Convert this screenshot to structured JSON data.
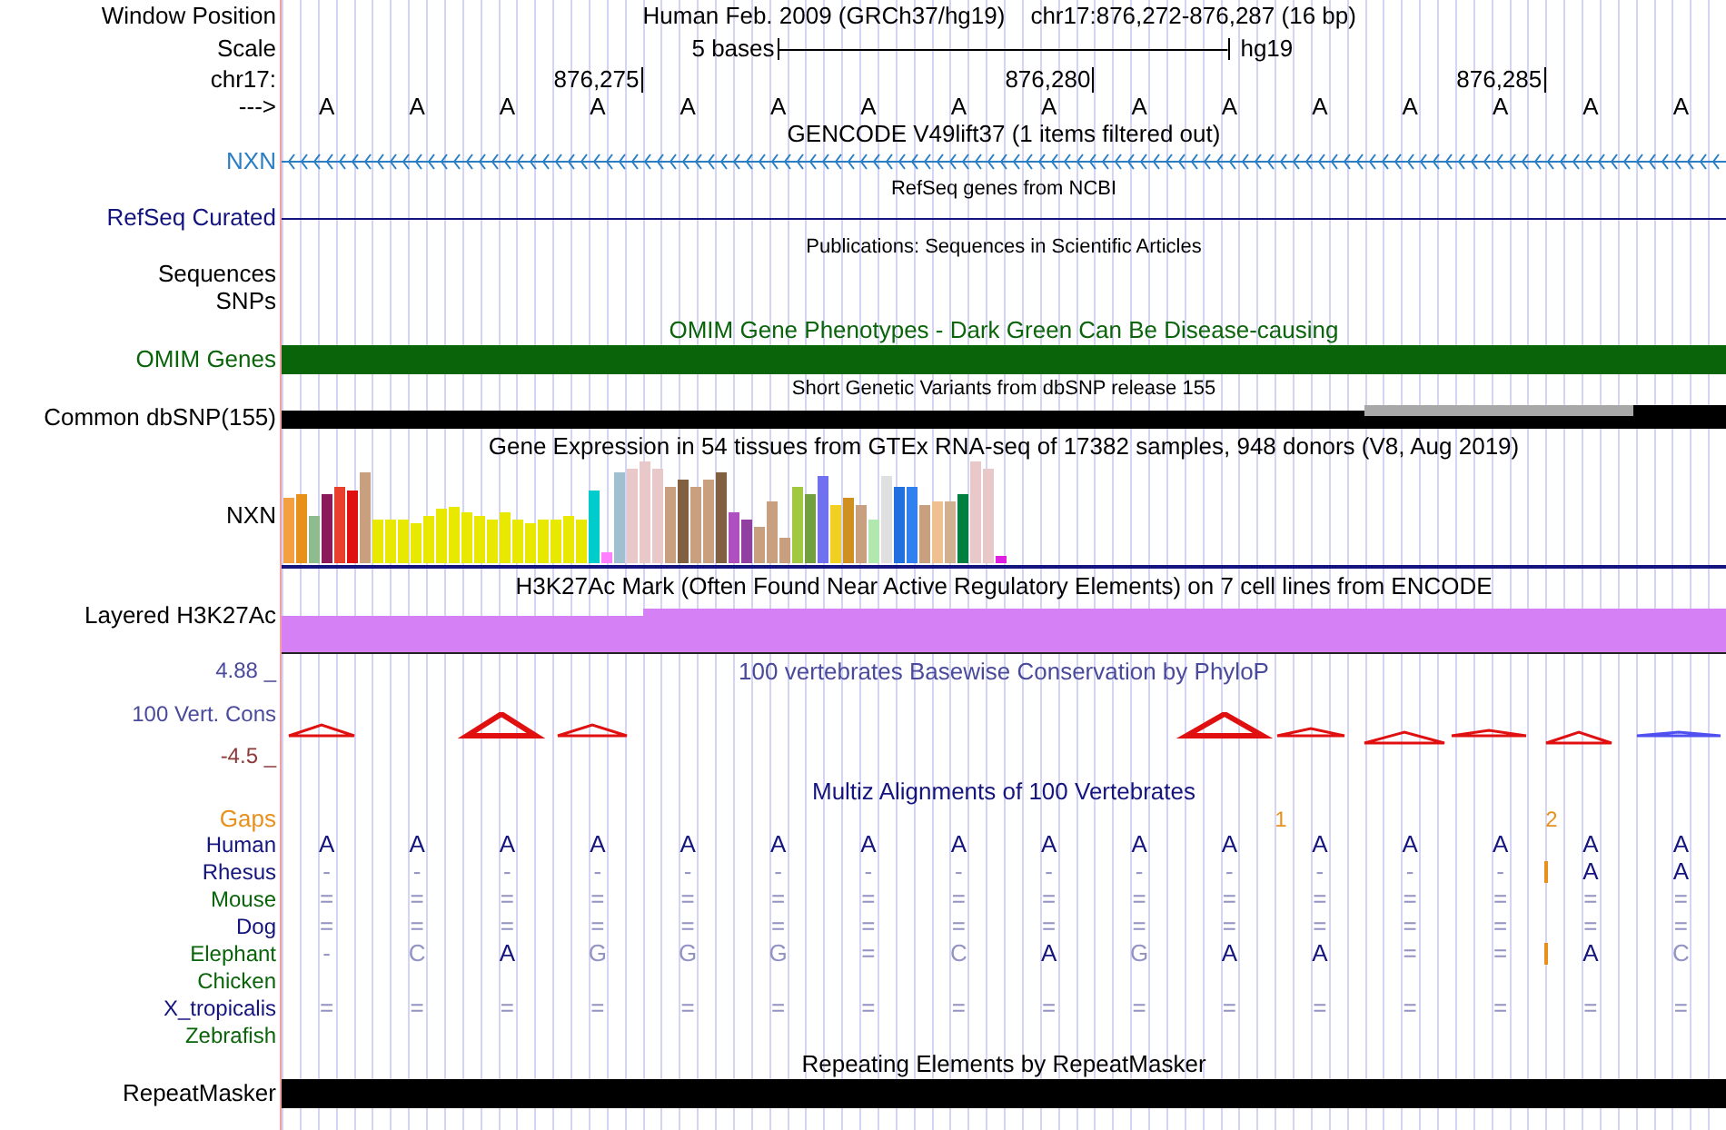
{
  "ruler": {
    "position_label": "Window Position",
    "assembly": "Human Feb. 2009 (GRCh37/hg19)",
    "range": "chr17:876,272-876,287 (16 bp)",
    "scale_label": "Scale",
    "scale_text": "5 bases",
    "scale_db": "hg19",
    "chrom_label": "chr17:",
    "ticks": [
      "876,275",
      "876,280",
      "876,285"
    ],
    "strand_label": "--->",
    "bases": [
      "A",
      "A",
      "A",
      "A",
      "A",
      "A",
      "A",
      "A",
      "A",
      "A",
      "A",
      "A",
      "A",
      "A",
      "A",
      "A"
    ]
  },
  "tracks": [
    {
      "kind": "gene",
      "title": "GENCODE V49lift37 (1 items filtered out)",
      "labels": [
        "NXN"
      ],
      "color": "#2a7ec4"
    },
    {
      "kind": "line",
      "title": "RefSeq genes from NCBI",
      "labels": [
        "RefSeq Curated"
      ],
      "color": "#14147e"
    },
    {
      "kind": "empty",
      "title": "Publications: Sequences in Scientific Articles",
      "labels": [
        "Sequences",
        "SNPs"
      ],
      "color": "#000000"
    },
    {
      "kind": "bar",
      "title": "OMIM Gene Phenotypes - Dark Green Can Be Disease-causing",
      "labels": [
        "OMIM Genes"
      ],
      "color": "#0a640a"
    },
    {
      "kind": "snp",
      "title": "Short Genetic Variants from dbSNP release 155",
      "labels": [
        "Common dbSNP(155)"
      ],
      "color": "#000000"
    },
    {
      "kind": "expression",
      "title": "Gene Expression in 54 tissues from GTEx RNA-seq of 17382 samples, 948 donors (V8, Aug 2019)",
      "labels": [
        "NXN"
      ],
      "color": "#000000"
    },
    {
      "kind": "layered",
      "title": "H3K27Ac Mark (Often Found Near Active Regulatory Elements) on 7 cell lines from ENCODE",
      "labels": [
        "Layered H3K27Ac"
      ],
      "color": "#000000"
    },
    {
      "kind": "phylop",
      "title": "100 vertebrates Basewise Conservation by PhyloP",
      "labels": [
        "100 Vert. Cons"
      ],
      "color": "#4a4a9c",
      "axis_max": "4.88 _",
      "axis_min": "-4.5 _"
    },
    {
      "kind": "multiz",
      "title": "Multiz Alignments of 100 Vertebrates",
      "labels": [
        "Gaps"
      ],
      "color": "#e8901c",
      "gap_labels": [
        "1",
        "2"
      ],
      "species": [
        {
          "name": "Human",
          "color": "#14147e",
          "bases": [
            {
              "text": "A",
              "match": true,
              "insert": false
            },
            {
              "text": "A",
              "match": true,
              "insert": false
            },
            {
              "text": "A",
              "match": true,
              "insert": false
            },
            {
              "text": "A",
              "match": true,
              "insert": false
            },
            {
              "text": "A",
              "match": true,
              "insert": false
            },
            {
              "text": "A",
              "match": true,
              "insert": false
            },
            {
              "text": "A",
              "match": true,
              "insert": false
            },
            {
              "text": "A",
              "match": true,
              "insert": false
            },
            {
              "text": "A",
              "match": true,
              "insert": false
            },
            {
              "text": "A",
              "match": true,
              "insert": false
            },
            {
              "text": "A",
              "match": true,
              "insert": false
            },
            {
              "text": "A",
              "match": true,
              "insert": false
            },
            {
              "text": "A",
              "match": true,
              "insert": false
            },
            {
              "text": "A",
              "match": true,
              "insert": false
            },
            {
              "text": "A",
              "match": true,
              "insert": false
            },
            {
              "text": "A",
              "match": true,
              "insert": false
            }
          ]
        },
        {
          "name": "Rhesus",
          "color": "#14147e",
          "bases": [
            {
              "text": "-",
              "match": false,
              "insert": false
            },
            {
              "text": "-",
              "match": false,
              "insert": false
            },
            {
              "text": "-",
              "match": false,
              "insert": false
            },
            {
              "text": "-",
              "match": false,
              "insert": false
            },
            {
              "text": "-",
              "match": false,
              "insert": false
            },
            {
              "text": "-",
              "match": false,
              "insert": false
            },
            {
              "text": "-",
              "match": false,
              "insert": false
            },
            {
              "text": "-",
              "match": false,
              "insert": false
            },
            {
              "text": "-",
              "match": false,
              "insert": false
            },
            {
              "text": "-",
              "match": false,
              "insert": false
            },
            {
              "text": "-",
              "match": false,
              "insert": false
            },
            {
              "text": "-",
              "match": false,
              "insert": false
            },
            {
              "text": "-",
              "match": false,
              "insert": false
            },
            {
              "text": "-",
              "match": false,
              "insert": false
            },
            {
              "text": "A",
              "match": true,
              "insert": true
            },
            {
              "text": "A",
              "match": true,
              "insert": false
            }
          ]
        },
        {
          "name": "Mouse",
          "color": "#0a640a",
          "bases": [
            {
              "text": "=",
              "match": false,
              "insert": false
            },
            {
              "text": "=",
              "match": false,
              "insert": false
            },
            {
              "text": "=",
              "match": false,
              "insert": false
            },
            {
              "text": "=",
              "match": false,
              "insert": false
            },
            {
              "text": "=",
              "match": false,
              "insert": false
            },
            {
              "text": "=",
              "match": false,
              "insert": false
            },
            {
              "text": "=",
              "match": false,
              "insert": false
            },
            {
              "text": "=",
              "match": false,
              "insert": false
            },
            {
              "text": "=",
              "match": false,
              "insert": false
            },
            {
              "text": "=",
              "match": false,
              "insert": false
            },
            {
              "text": "=",
              "match": false,
              "insert": false
            },
            {
              "text": "=",
              "match": false,
              "insert": false
            },
            {
              "text": "=",
              "match": false,
              "insert": false
            },
            {
              "text": "=",
              "match": false,
              "insert": false
            },
            {
              "text": "=",
              "match": false,
              "insert": false
            },
            {
              "text": "=",
              "match": false,
              "insert": false
            }
          ]
        },
        {
          "name": "Dog",
          "color": "#14147e",
          "bases": [
            {
              "text": "=",
              "match": false,
              "insert": false
            },
            {
              "text": "=",
              "match": false,
              "insert": false
            },
            {
              "text": "=",
              "match": false,
              "insert": false
            },
            {
              "text": "=",
              "match": false,
              "insert": false
            },
            {
              "text": "=",
              "match": false,
              "insert": false
            },
            {
              "text": "=",
              "match": false,
              "insert": false
            },
            {
              "text": "=",
              "match": false,
              "insert": false
            },
            {
              "text": "=",
              "match": false,
              "insert": false
            },
            {
              "text": "=",
              "match": false,
              "insert": false
            },
            {
              "text": "=",
              "match": false,
              "insert": false
            },
            {
              "text": "=",
              "match": false,
              "insert": false
            },
            {
              "text": "=",
              "match": false,
              "insert": false
            },
            {
              "text": "=",
              "match": false,
              "insert": false
            },
            {
              "text": "=",
              "match": false,
              "insert": false
            },
            {
              "text": "=",
              "match": false,
              "insert": false
            },
            {
              "text": "=",
              "match": false,
              "insert": false
            }
          ]
        },
        {
          "name": "Elephant",
          "color": "#0a640a",
          "bases": [
            {
              "text": "-",
              "match": false,
              "insert": false
            },
            {
              "text": "C",
              "match": false,
              "insert": false
            },
            {
              "text": "A",
              "match": true,
              "insert": false
            },
            {
              "text": "G",
              "match": false,
              "insert": false
            },
            {
              "text": "G",
              "match": false,
              "insert": false
            },
            {
              "text": "G",
              "match": false,
              "insert": false
            },
            {
              "text": "=",
              "match": false,
              "insert": false
            },
            {
              "text": "C",
              "match": false,
              "insert": false
            },
            {
              "text": "A",
              "match": true,
              "insert": false
            },
            {
              "text": "G",
              "match": false,
              "insert": false
            },
            {
              "text": "A",
              "match": true,
              "insert": false
            },
            {
              "text": "A",
              "match": true,
              "insert": false
            },
            {
              "text": "=",
              "match": false,
              "insert": false
            },
            {
              "text": "=",
              "match": false,
              "insert": false
            },
            {
              "text": "A",
              "match": true,
              "insert": true
            },
            {
              "text": "C",
              "match": false,
              "insert": false
            }
          ]
        },
        {
          "name": "Chicken",
          "color": "#0a640a"
        },
        {
          "name": "X_tropicalis",
          "color": "#14147e",
          "bases": [
            {
              "text": "=",
              "match": false,
              "insert": false
            },
            {
              "text": "=",
              "match": false,
              "insert": false
            },
            {
              "text": "=",
              "match": false,
              "insert": false
            },
            {
              "text": "=",
              "match": false,
              "insert": false
            },
            {
              "text": "=",
              "match": false,
              "insert": false
            },
            {
              "text": "=",
              "match": false,
              "insert": false
            },
            {
              "text": "=",
              "match": false,
              "insert": false
            },
            {
              "text": "=",
              "match": false,
              "insert": false
            },
            {
              "text": "=",
              "match": false,
              "insert": false
            },
            {
              "text": "=",
              "match": false,
              "insert": false
            },
            {
              "text": "=",
              "match": false,
              "insert": false
            },
            {
              "text": "=",
              "match": false,
              "insert": false
            },
            {
              "text": "=",
              "match": false,
              "insert": false
            },
            {
              "text": "=",
              "match": false,
              "insert": false
            },
            {
              "text": "=",
              "match": false,
              "insert": false
            },
            {
              "text": "=",
              "match": false,
              "insert": false
            }
          ]
        },
        {
          "name": "Zebrafish",
          "color": "#0a640a"
        }
      ]
    },
    {
      "kind": "bar",
      "title": "Repeating Elements by RepeatMasker",
      "labels": [
        "RepeatMasker"
      ],
      "color": "#000000"
    }
  ]
}
